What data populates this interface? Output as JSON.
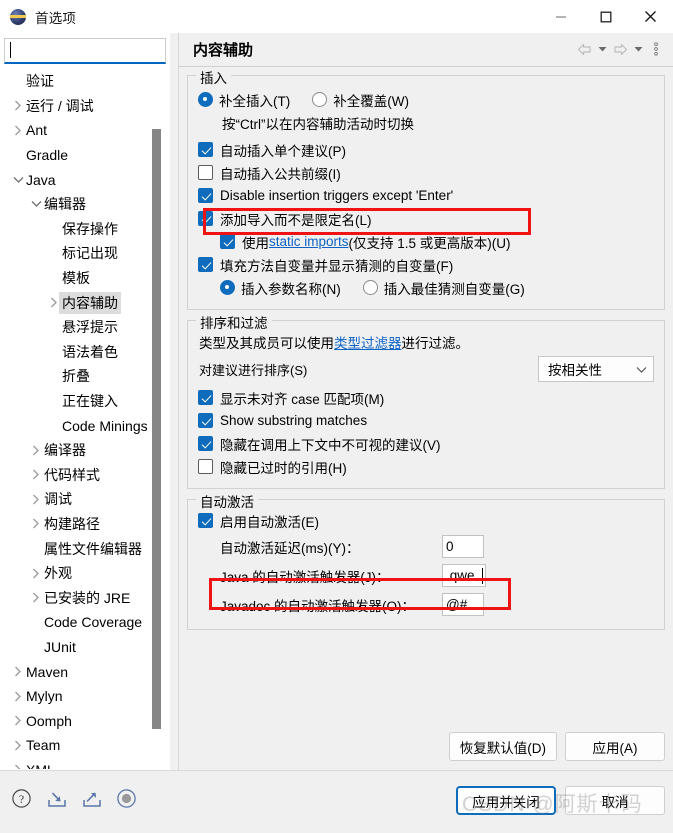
{
  "window": {
    "title": "首选项",
    "app_icon": "eclipse-icon",
    "minimize": "−",
    "maximize": "▢",
    "close": "✕"
  },
  "search": {
    "value": "",
    "placeholder": ""
  },
  "sidebar": {
    "items": [
      {
        "label": "验证",
        "indent": 1,
        "twisty": "none",
        "selected": false
      },
      {
        "label": "运行 / 调试",
        "indent": 1,
        "twisty": "collapsed",
        "selected": false
      },
      {
        "label": "Ant",
        "indent": 1,
        "twisty": "collapsed",
        "selected": false
      },
      {
        "label": "Gradle",
        "indent": 1,
        "twisty": "none",
        "selected": false
      },
      {
        "label": "Java",
        "indent": 1,
        "twisty": "expanded",
        "selected": false
      },
      {
        "label": "编辑器",
        "indent": 2,
        "twisty": "expanded",
        "selected": false
      },
      {
        "label": "保存操作",
        "indent": 3,
        "twisty": "none",
        "selected": false
      },
      {
        "label": "标记出现",
        "indent": 3,
        "twisty": "none",
        "selected": false
      },
      {
        "label": "模板",
        "indent": 3,
        "twisty": "none",
        "selected": false
      },
      {
        "label": "内容辅助",
        "indent": 3,
        "twisty": "collapsed",
        "selected": true
      },
      {
        "label": "悬浮提示",
        "indent": 3,
        "twisty": "none",
        "selected": false
      },
      {
        "label": "语法着色",
        "indent": 3,
        "twisty": "none",
        "selected": false
      },
      {
        "label": "折叠",
        "indent": 3,
        "twisty": "none",
        "selected": false
      },
      {
        "label": "正在键入",
        "indent": 3,
        "twisty": "none",
        "selected": false
      },
      {
        "label": "Code Minings",
        "indent": 3,
        "twisty": "none",
        "selected": false
      },
      {
        "label": "编译器",
        "indent": 2,
        "twisty": "collapsed",
        "selected": false
      },
      {
        "label": "代码样式",
        "indent": 2,
        "twisty": "collapsed",
        "selected": false
      },
      {
        "label": "调试",
        "indent": 2,
        "twisty": "collapsed",
        "selected": false
      },
      {
        "label": "构建路径",
        "indent": 2,
        "twisty": "collapsed",
        "selected": false
      },
      {
        "label": "属性文件编辑器",
        "indent": 2,
        "twisty": "none",
        "selected": false
      },
      {
        "label": "外观",
        "indent": 2,
        "twisty": "collapsed",
        "selected": false
      },
      {
        "label": "已安装的 JRE",
        "indent": 2,
        "twisty": "collapsed",
        "selected": false
      },
      {
        "label": "Code Coverage",
        "indent": 2,
        "twisty": "none",
        "selected": false
      },
      {
        "label": "JUnit",
        "indent": 2,
        "twisty": "none",
        "selected": false
      },
      {
        "label": "Maven",
        "indent": 1,
        "twisty": "collapsed",
        "selected": false
      },
      {
        "label": "Mylyn",
        "indent": 1,
        "twisty": "collapsed",
        "selected": false
      },
      {
        "label": "Oomph",
        "indent": 1,
        "twisty": "collapsed",
        "selected": false
      },
      {
        "label": "Team",
        "indent": 1,
        "twisty": "collapsed",
        "selected": false
      },
      {
        "label": "XML",
        "indent": 1,
        "twisty": "collapsed",
        "selected": false
      }
    ]
  },
  "page": {
    "title": "内容辅助",
    "toolbar": {
      "back": "back-arrow",
      "back_menu": "chevron-down",
      "forward": "forward-arrow",
      "forward_menu": "chevron-down",
      "more": "vertical-ellipsis"
    },
    "groups": {
      "insertion": {
        "title": "插入",
        "radio_insert": "补全插入(T)",
        "radio_overwrite": "补全覆盖(W)",
        "hint": "按“Ctrl”以在内容辅助活动时切换",
        "cb_single_proposal": "自动插入单个建议(P)",
        "cb_common_prefix": "自动插入公共前缀(I)",
        "cb_disable_triggers": "Disable insertion triggers except 'Enter'",
        "cb_add_import": "添加导入而不是限定名(L)",
        "cb_static_imports_pre": "使用 ",
        "cb_static_imports_link": "static imports",
        "cb_static_imports_post": " (仅支持 1.5 或更高版本)(U)",
        "cb_fill_args": "填充方法自变量并显示猜测的自变量(F)",
        "radio_param_names": "插入参数名称(N)",
        "radio_best_guess": "插入最佳猜测自变量(G)"
      },
      "sorting": {
        "title": "排序和过滤",
        "desc_pre": "类型及其成员可以使用 ",
        "desc_link": "类型过滤器",
        "desc_post": " 进行过滤。",
        "sort_label": "对建议进行排序(S)",
        "sort_value": "按相关性",
        "cb_unaligned_case": "显示未对齐 case 匹配项(M)",
        "cb_substring": "Show substring matches",
        "cb_hide_invisible": "隐藏在调用上下文中不可视的建议(V)",
        "cb_hide_deprecated": "隐藏已过时的引用(H)"
      },
      "autoactivation": {
        "title": "自动激活",
        "cb_enable": "启用自动激活(E)",
        "delay_label": "自动激活延迟(ms)(Y)：",
        "delay_value": "0",
        "java_label": "Java 的自动激活触发器(J)：",
        "java_value": ".qwe",
        "javadoc_label": "Javadoc 的自动激活触发器(O)：",
        "javadoc_value": "@#"
      }
    },
    "buttons": {
      "restore_defaults": "恢复默认值(D)",
      "apply": "应用(A)"
    }
  },
  "footer": {
    "icons": [
      "help-icon",
      "import-icon",
      "export-icon",
      "toggle-icon"
    ],
    "apply_and_close": "应用并关闭",
    "cancel": "取消"
  },
  "watermark": "CSDN @阿斯卡码",
  "colors": {
    "accent": "#0f6cbd",
    "highlight": "#ef1313",
    "link": "#0b62c6",
    "selection": "#dcdcdc",
    "panel": "#f0f0f0"
  }
}
